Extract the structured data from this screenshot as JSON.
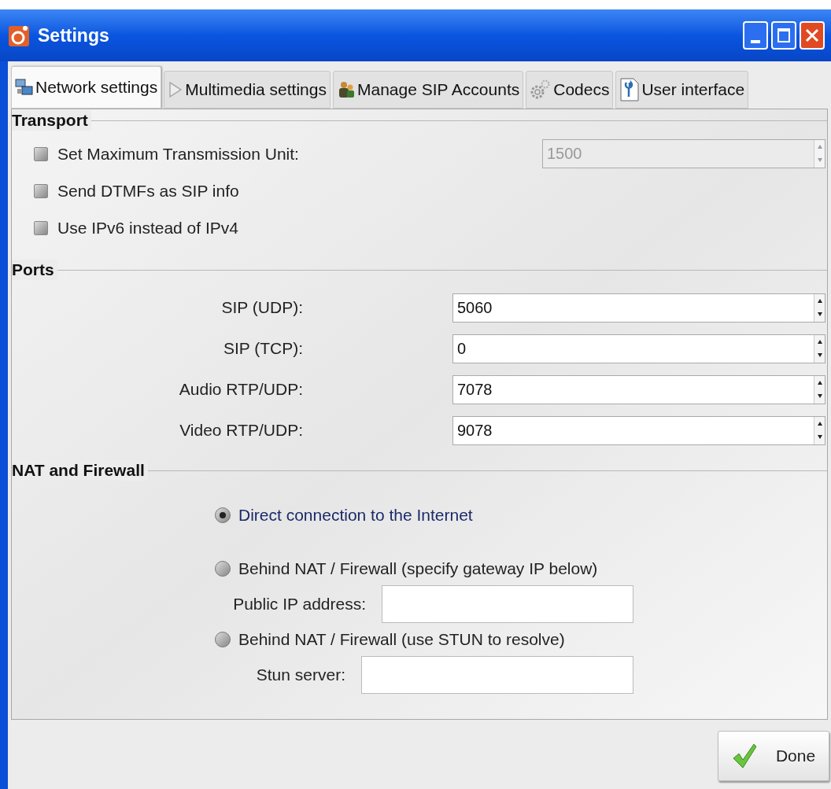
{
  "window": {
    "title": "Settings"
  },
  "tabs": [
    {
      "label": "Network settings",
      "selected": true
    },
    {
      "label": "Multimedia settings",
      "selected": false
    },
    {
      "label": "Manage SIP Accounts",
      "selected": false
    },
    {
      "label": "Codecs",
      "selected": false
    },
    {
      "label": "User interface",
      "selected": false
    }
  ],
  "transport": {
    "title": "Transport",
    "options": [
      {
        "label": "Set Maximum Transmission Unit:",
        "checked": false,
        "spin": {
          "value": "1500",
          "disabled": true
        }
      },
      {
        "label": "Send DTMFs as SIP info",
        "checked": false
      },
      {
        "label": "Use IPv6 instead of IPv4",
        "checked": false
      }
    ]
  },
  "ports": {
    "title": "Ports",
    "rows": [
      {
        "label": "SIP (UDP):",
        "value": "5060"
      },
      {
        "label": "SIP (TCP):",
        "value": "0"
      },
      {
        "label": "Audio RTP/UDP:",
        "value": "7078"
      },
      {
        "label": "Video RTP/UDP:",
        "value": "9078"
      }
    ]
  },
  "nat": {
    "title": "NAT and Firewall",
    "options": [
      {
        "label": "Direct connection to the Internet",
        "selected": true
      },
      {
        "label": "Behind NAT / Firewall (specify gateway IP below)",
        "selected": false,
        "field": {
          "label": "Public IP address:"
        }
      },
      {
        "label": "Behind NAT / Firewall (use STUN to resolve)",
        "selected": false,
        "field": {
          "label": "Stun server:"
        }
      }
    ]
  },
  "buttons": [
    {
      "label": "Done"
    }
  ]
}
